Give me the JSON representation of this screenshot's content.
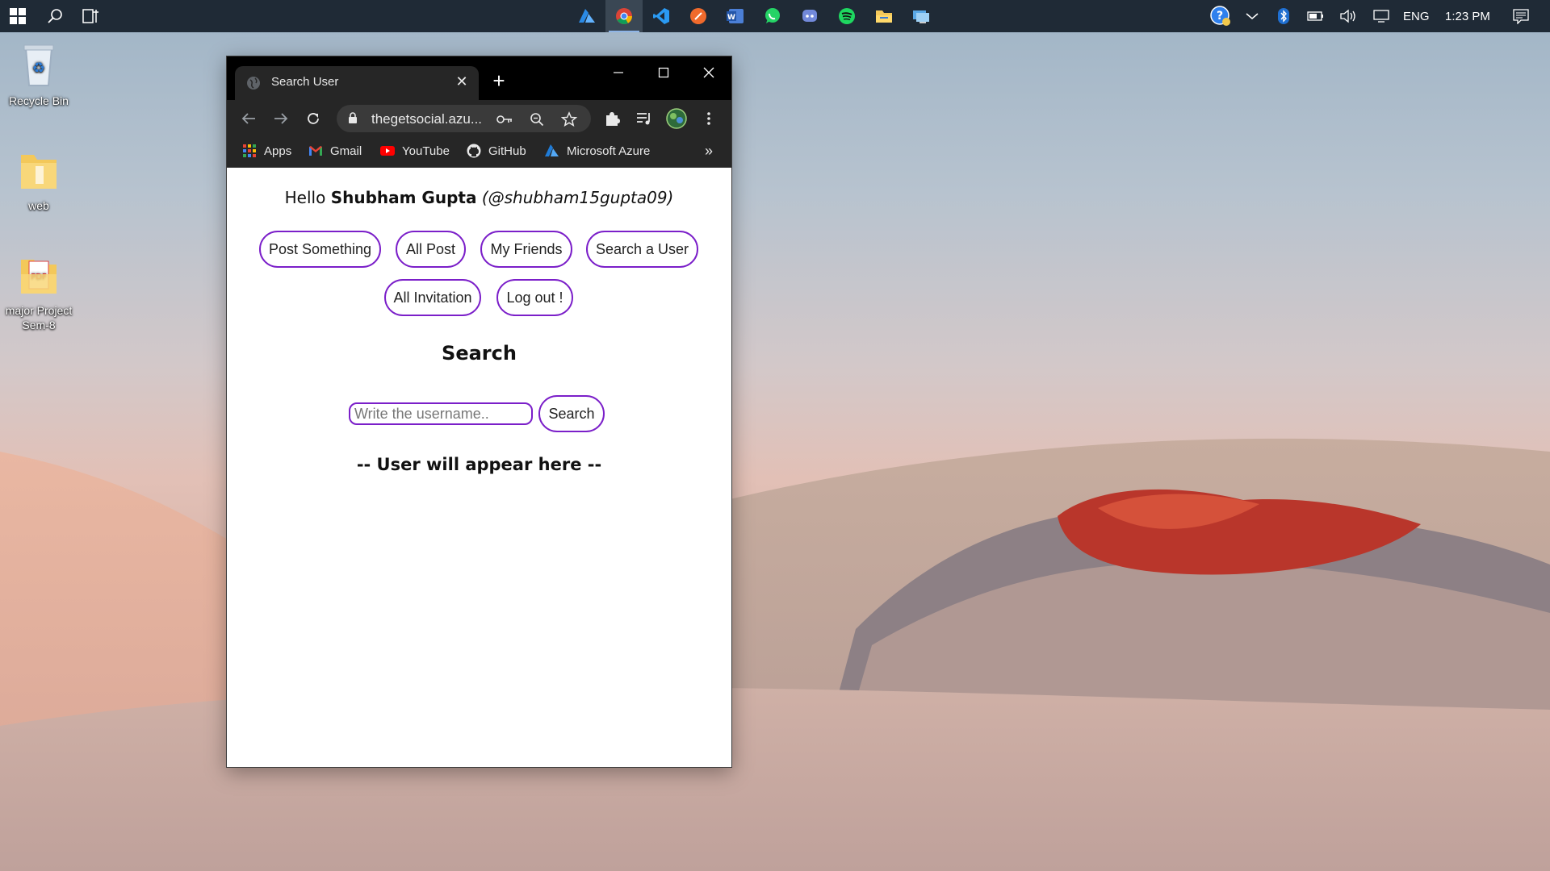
{
  "taskbar": {
    "clock": "1:23 PM",
    "language": "ENG",
    "pinned_apps": [
      "azure-icon",
      "chrome-icon",
      "vscode-icon",
      "postman-icon",
      "word-icon",
      "whatsapp-icon",
      "discord-icon",
      "spotify-icon",
      "file-explorer-icon",
      "remote-desktop-icon"
    ],
    "active_app": "chrome-icon"
  },
  "desktop": {
    "icons": [
      {
        "label": "Recycle Bin",
        "icon": "recycle-bin-icon"
      },
      {
        "label": "web",
        "icon": "folder-icon"
      },
      {
        "label": "major Project Sem-8",
        "icon": "pdf-folder-icon"
      }
    ]
  },
  "browser": {
    "tab_title": "Search User",
    "url": "thegetsocial.azu...",
    "bookmarks": [
      {
        "label": "Apps",
        "icon": "apps-grid-icon"
      },
      {
        "label": "Gmail",
        "icon": "gmail-icon"
      },
      {
        "label": "YouTube",
        "icon": "youtube-icon"
      },
      {
        "label": "GitHub",
        "icon": "github-icon"
      },
      {
        "label": "Microsoft Azure",
        "icon": "azure-icon"
      }
    ],
    "overflow": "»"
  },
  "page": {
    "greeting": {
      "prefix": "Hello",
      "name": "Shubham Gupta",
      "handle": "(@shubham15gupta09)"
    },
    "nav": {
      "post_something": "Post Something",
      "all_post": "All Post",
      "my_friends": "My Friends",
      "search_user": "Search a User",
      "all_invitation": "All Invitation",
      "logout": "Log out !"
    },
    "search": {
      "title": "Search",
      "placeholder": "Write the username..",
      "value": "",
      "button": "Search"
    },
    "result_message": "-- User will appear here --"
  },
  "colors": {
    "accent": "#7b1fc9",
    "taskbar": "#1f2a36",
    "browser_chrome": "#262626"
  }
}
